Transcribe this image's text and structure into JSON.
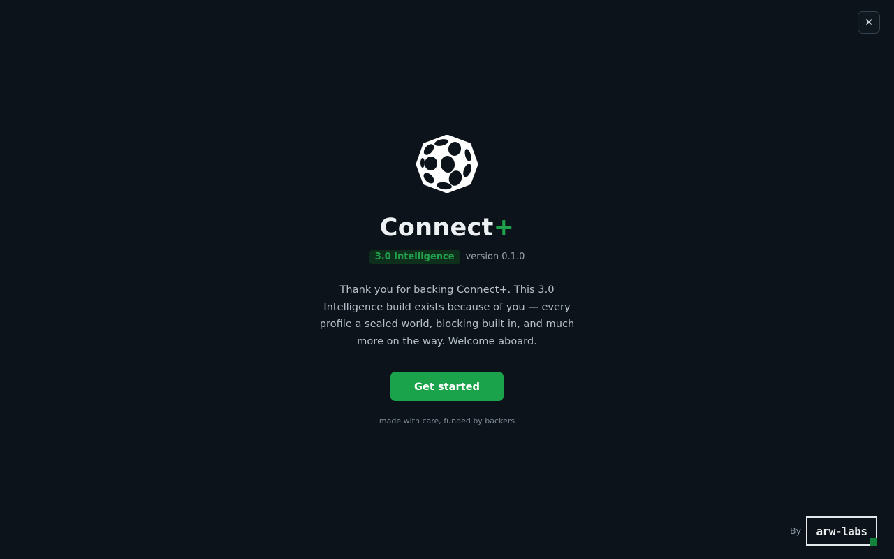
{
  "window": {
    "close_glyph": "✕"
  },
  "app": {
    "name": "Connect",
    "name_suffix": "+",
    "badge": "3.0 Intelligence",
    "version": "version 0.1.0",
    "welcome_message": "Thank you for backing Connect+. This 3.0 Intelligence build exists because of you — every profile a sealed world, blocking built in, and much more on the way. Welcome aboard.",
    "cta_label": "Get started",
    "footnote": "made with care, funded by backers"
  },
  "footer": {
    "by_label": "By",
    "brand": "arw-labs"
  },
  "icons": {
    "logo": "dimpled-hexagon-logo",
    "close": "close-icon"
  },
  "colors": {
    "background": "#0c131b",
    "accent": "#1aa34a",
    "badge_bg": "#0f2f1d",
    "text_primary": "#eef1f4",
    "text_secondary": "#b6bfc8"
  }
}
